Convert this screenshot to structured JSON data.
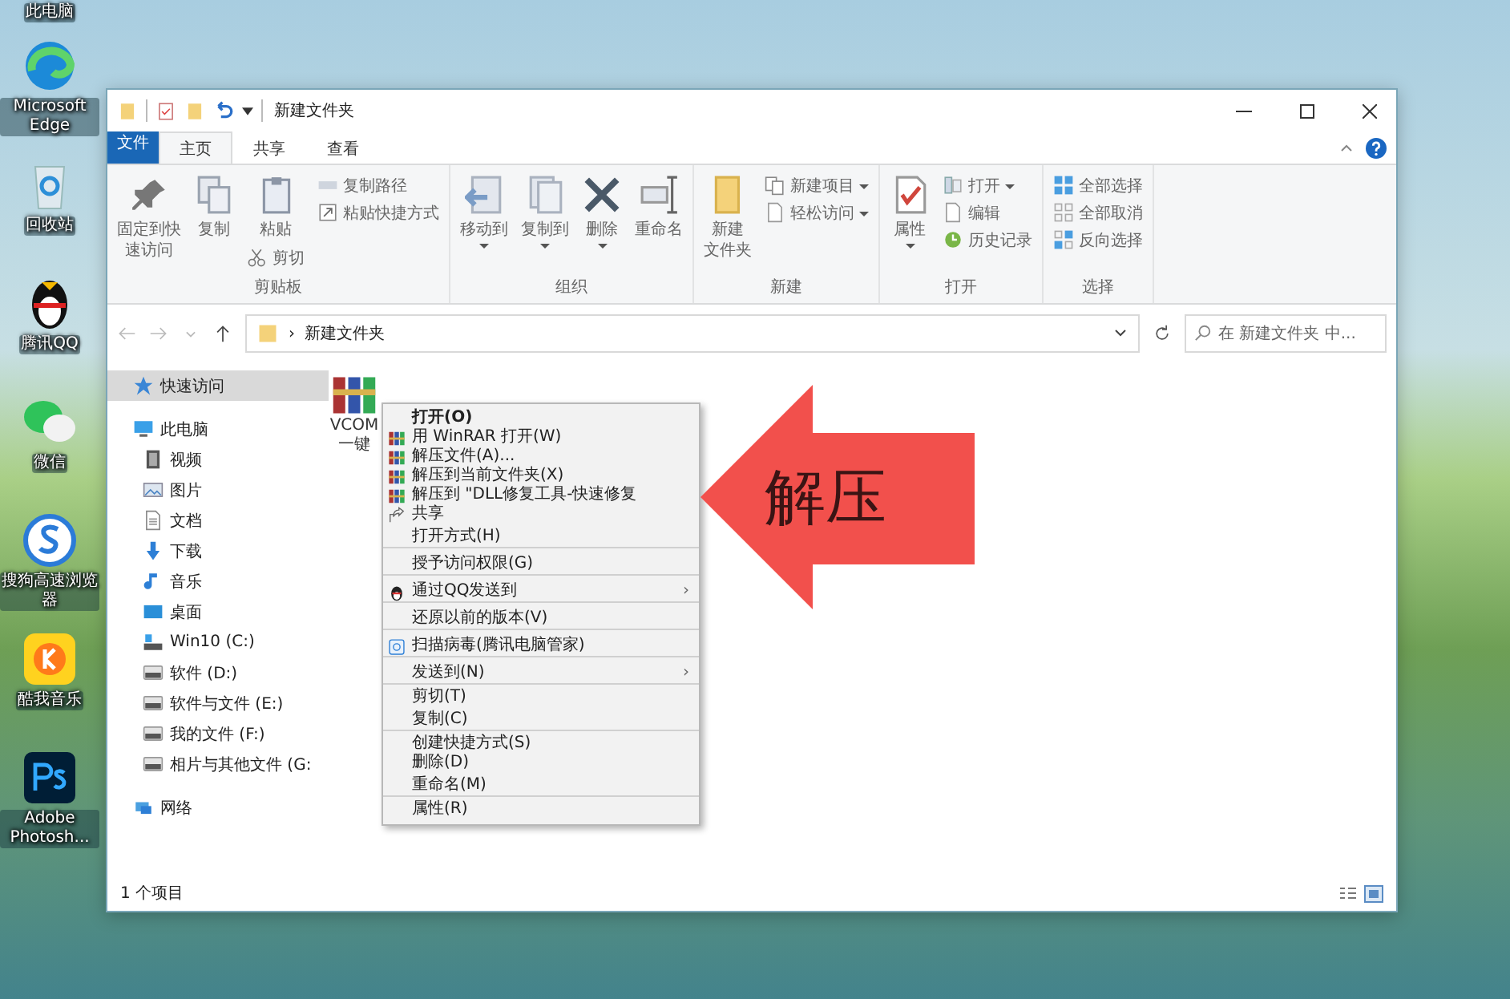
{
  "desktop_icons": [
    {
      "label": "此电脑",
      "kind": "none"
    },
    {
      "label": "Microsoft Edge",
      "kind": "swirl"
    },
    {
      "label": "回收站",
      "kind": "bin"
    },
    {
      "label": "腾讯QQ",
      "kind": "penguin"
    },
    {
      "label": "微信",
      "kind": "chat"
    },
    {
      "label": "搜狗高速浏览器",
      "kind": "s-circle"
    },
    {
      "label": "酷我音乐",
      "kind": "music-app"
    },
    {
      "label": "Adobe Photosh...",
      "kind": "ps"
    }
  ],
  "window": {
    "title": "新建文件夹"
  },
  "ribbon_tabs": [
    {
      "label": "文件",
      "selected": false,
      "kind": "file"
    },
    {
      "label": "主页",
      "selected": true,
      "kind": "tab"
    },
    {
      "label": "共享",
      "selected": false,
      "kind": "tab"
    },
    {
      "label": "查看",
      "selected": false,
      "kind": "tab"
    }
  ],
  "ribbon_groups": [
    {
      "label": "剪贴板",
      "columns": [
        {
          "kind": "pin",
          "lines": [
            "固定到快",
            "速访问"
          ],
          "dropdown": false
        },
        {
          "kind": "copy",
          "lines": [
            "复制"
          ],
          "dropdown": false
        },
        {
          "kind": "clipboard",
          "lines": [
            "粘贴"
          ],
          "dropdown": false,
          "extra": {
            "kind": "scissors",
            "label": "剪切",
            "dropdown": false
          }
        },
        {
          "kind": "stack",
          "items": [
            {
              "kind": "path",
              "label": "复制路径",
              "dropdown": false
            },
            {
              "kind": "shortcut",
              "label": "粘贴快捷方式",
              "dropdown": false
            }
          ]
        }
      ]
    },
    {
      "label": "组织",
      "columns": [
        {
          "kind": "move",
          "lines": [
            "移动到"
          ],
          "dropdown": true
        },
        {
          "kind": "copyto",
          "lines": [
            "复制到"
          ],
          "dropdown": true
        },
        {
          "kind": "delete",
          "lines": [
            "删除"
          ],
          "dropdown": true
        },
        {
          "kind": "rename",
          "lines": [
            "重命名"
          ],
          "dropdown": false
        }
      ]
    },
    {
      "label": "新建",
      "columns": [
        {
          "kind": "folder",
          "lines": [
            "新建",
            "文件夹"
          ],
          "dropdown": false
        },
        {
          "kind": "stack",
          "items": [
            {
              "kind": "newitem",
              "label": "新建项目",
              "dropdown": true
            },
            {
              "kind": "page",
              "label": "轻松访问",
              "dropdown": true
            }
          ]
        }
      ]
    },
    {
      "label": "打开",
      "columns": [
        {
          "kind": "checkdoc",
          "lines": [
            "属性"
          ],
          "dropdown": true
        },
        {
          "kind": "stack",
          "items": [
            {
              "kind": "open",
              "label": "打开",
              "dropdown": true
            },
            {
              "kind": "page",
              "label": "编辑",
              "dropdown": false
            },
            {
              "kind": "history",
              "label": "历史记录",
              "dropdown": false
            }
          ]
        }
      ]
    },
    {
      "label": "选择",
      "columns": [
        {
          "kind": "stack",
          "items": [
            {
              "kind": "gridfull",
              "label": "全部选择",
              "dropdown": false
            },
            {
              "kind": "gridempty",
              "label": "全部取消",
              "dropdown": false
            },
            {
              "kind": "gridinvert",
              "label": "反向选择",
              "dropdown": false
            }
          ]
        }
      ]
    }
  ],
  "address_bar": {
    "path": "新建文件夹",
    "separator": "›"
  },
  "search": {
    "placeholder": "在 新建文件夹 中..."
  },
  "navigation": [
    {
      "label": "快速访问",
      "kind": "star",
      "selected": true
    },
    {
      "label": "此电脑",
      "kind": "pc",
      "selected": false,
      "children": [
        {
          "label": "视频",
          "kind": "video",
          "selected": false
        },
        {
          "label": "图片",
          "kind": "picture",
          "selected": false
        },
        {
          "label": "文档",
          "kind": "document",
          "selected": false
        },
        {
          "label": "下载",
          "kind": "download",
          "selected": false
        },
        {
          "label": "音乐",
          "kind": "music",
          "selected": false
        },
        {
          "label": "桌面",
          "kind": "desktop",
          "selected": false
        },
        {
          "label": "Win10 (C:)",
          "kind": "sysdrive",
          "selected": false
        },
        {
          "label": "软件 (D:)",
          "kind": "drive",
          "selected": false
        },
        {
          "label": "软件与文件 (E:)",
          "kind": "drive",
          "selected": false
        },
        {
          "label": "我的文件 (F:)",
          "kind": "drive",
          "selected": false
        },
        {
          "label": "相片与其他文件 (G:",
          "kind": "drive",
          "selected": false
        }
      ]
    },
    {
      "label": "网络",
      "kind": "network",
      "selected": false
    }
  ],
  "files": [
    {
      "lines": [
        "VCOM",
        "一键"
      ]
    }
  ],
  "context_menu": [
    {
      "label": "打开(O)",
      "kind": "none",
      "bold": true,
      "submenu": false,
      "separator_after": false
    },
    {
      "label": "用 WinRAR 打开(W)",
      "kind": "books",
      "bold": false,
      "submenu": false,
      "separator_after": false
    },
    {
      "label": "解压文件(A)...",
      "kind": "books",
      "bold": false,
      "submenu": false,
      "separator_after": false
    },
    {
      "label": "解压到当前文件夹(X)",
      "kind": "books",
      "bold": false,
      "submenu": false,
      "separator_after": false
    },
    {
      "label": "解压到 \"DLL修复工具-快速修复",
      "kind": "books",
      "bold": false,
      "submenu": false,
      "separator_after": false
    },
    {
      "label": "共享",
      "kind": "share",
      "bold": false,
      "submenu": false,
      "separator_after": false
    },
    {
      "label": "打开方式(H)",
      "kind": "none",
      "bold": false,
      "submenu": false,
      "separator_after": true
    },
    {
      "label": "授予访问权限(G)",
      "kind": "none",
      "bold": false,
      "submenu": false,
      "separator_after": true
    },
    {
      "label": "通过QQ发送到",
      "kind": "penguin",
      "bold": false,
      "submenu": true,
      "separator_after": true
    },
    {
      "label": "还原以前的版本(V)",
      "kind": "none",
      "bold": false,
      "submenu": false,
      "separator_after": true
    },
    {
      "label": "扫描病毒(腾讯电脑管家)",
      "kind": "shield",
      "bold": false,
      "submenu": false,
      "separator_after": true
    },
    {
      "label": "发送到(N)",
      "kind": "none",
      "bold": false,
      "submenu": true,
      "separator_after": true
    },
    {
      "label": "剪切(T)",
      "kind": "none",
      "bold": false,
      "submenu": false,
      "separator_after": false
    },
    {
      "label": "复制(C)",
      "kind": "none",
      "bold": false,
      "submenu": false,
      "separator_after": true
    },
    {
      "label": "创建快捷方式(S)",
      "kind": "none",
      "bold": false,
      "submenu": false,
      "separator_after": false
    },
    {
      "label": "删除(D)",
      "kind": "none",
      "bold": false,
      "submenu": false,
      "separator_after": false
    },
    {
      "label": "重命名(M)",
      "kind": "none",
      "bold": false,
      "submenu": false,
      "separator_after": true
    },
    {
      "label": "属性(R)",
      "kind": "none",
      "bold": false,
      "submenu": false,
      "separator_after": false
    }
  ],
  "submenu_arrow": "›",
  "status_bar": {
    "count": "1 个项目"
  },
  "annotation": {
    "text": "解压"
  }
}
